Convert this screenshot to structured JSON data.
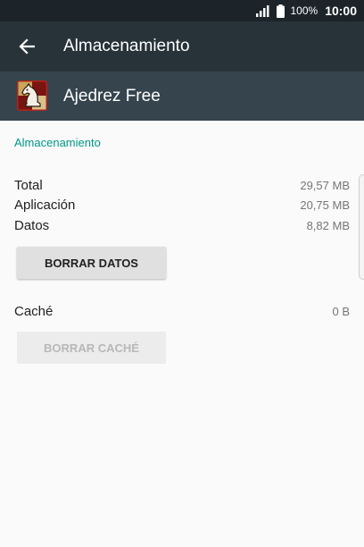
{
  "status_bar": {
    "battery_percent": "100%",
    "time": "10:00",
    "icons": [
      "signal-icon",
      "battery-icon"
    ]
  },
  "toolbar": {
    "back_icon": "arrow-left-icon",
    "title": "Almacenamiento"
  },
  "app": {
    "name": "Ajedrez Free",
    "icon": "chess-knight-icon"
  },
  "storage": {
    "section_title": "Almacenamiento",
    "rows": [
      {
        "label": "Total",
        "value": "29,57 MB"
      },
      {
        "label": "Aplicación",
        "value": "20,75 MB"
      },
      {
        "label": "Datos",
        "value": "8,82 MB"
      }
    ],
    "clear_data_label": "BORRAR DATOS",
    "cache": {
      "label": "Caché",
      "value": "0 B"
    },
    "clear_cache_label": "BORRAR CACHÉ",
    "clear_cache_enabled": false
  },
  "colors": {
    "status_bar": "#1c2429",
    "toolbar": "#283339",
    "app_header": "#36454d",
    "accent": "#009688",
    "background": "#fafafa"
  }
}
